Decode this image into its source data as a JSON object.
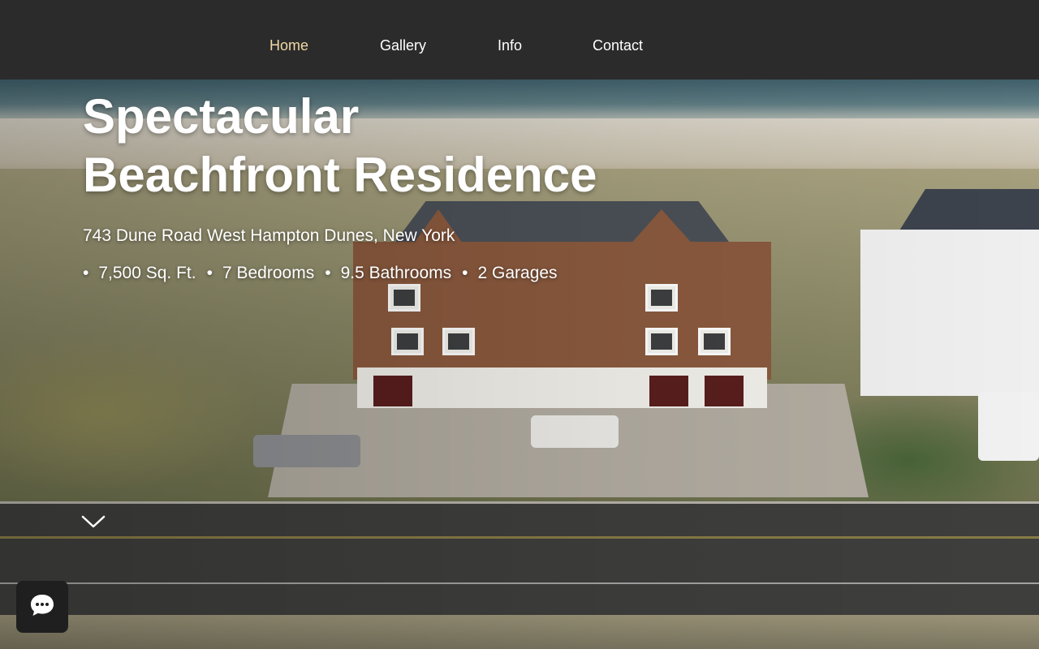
{
  "nav": {
    "items": [
      {
        "label": "Home",
        "active": true
      },
      {
        "label": "Gallery",
        "active": false
      },
      {
        "label": "Info",
        "active": false
      },
      {
        "label": "Contact",
        "active": false
      }
    ]
  },
  "hero": {
    "title_line1": "Spectacular",
    "title_line2": "Beachfront Residence",
    "address": "743 Dune Road West Hampton Dunes, New York",
    "features": [
      "7,500 Sq. Ft.",
      "7 Bedrooms",
      "9.5 Bathrooms",
      "2 Garages"
    ],
    "bullet": "•",
    "scroll_icon": "chevron-down-icon"
  },
  "chat": {
    "icon": "chat-bubble-icon"
  },
  "colors": {
    "nav_bg": "#2b2b2b",
    "nav_active": "#f1d8a6",
    "nav_text": "#ffffff",
    "chat_bg": "#1f1f1f"
  }
}
